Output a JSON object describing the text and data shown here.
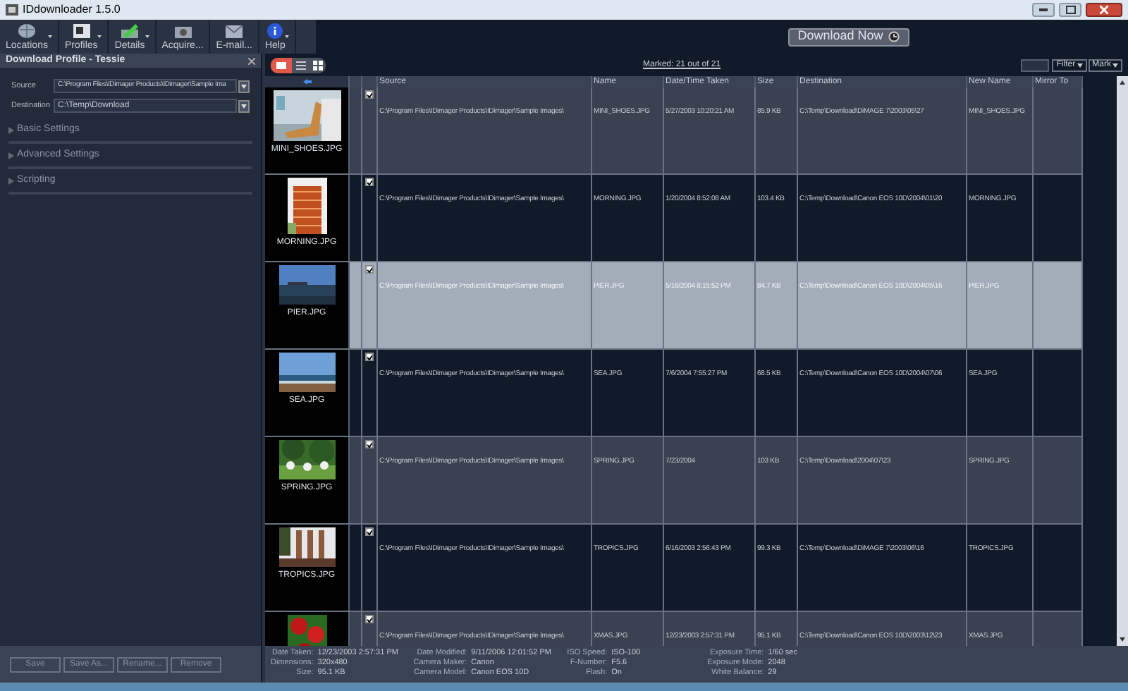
{
  "window": {
    "title": "IDdownloader 1.5.0"
  },
  "toolbar": [
    {
      "label": "Locations",
      "dropdown": true
    },
    {
      "label": "Profiles",
      "dropdown": true
    },
    {
      "label": "Details",
      "dropdown": true
    },
    {
      "label": "Acquire...",
      "dropdown": false
    },
    {
      "label": "E-mail...",
      "dropdown": false
    },
    {
      "label": "Help",
      "dropdown": true
    }
  ],
  "download_button": {
    "label": "Download Now"
  },
  "profile_panel": {
    "title": "Download Profile - Tessie",
    "source_label": "Source",
    "source_value": "C:\\Program Files\\IDimager Products\\IDimager\\Sample Ima",
    "destination_label": "Destination",
    "destination_value": "C:\\Temp\\Download",
    "sections": [
      {
        "label": "Basic Settings",
        "expanded": false
      },
      {
        "label": "Advanced Settings",
        "expanded": false
      },
      {
        "label": "Scripting",
        "expanded": false
      }
    ],
    "buttons": [
      "Save",
      "Save As...",
      "Rename...",
      "Remove"
    ]
  },
  "view_modes": [
    {
      "selected": true
    },
    {
      "selected": false
    },
    {
      "selected": false
    }
  ],
  "marked_link": "Marked: 21 out of 21",
  "filter_button": "Filter",
  "mark_button": "Mark",
  "table": {
    "columns": [
      "Source",
      "Name",
      "Date/Time Taken",
      "Size",
      "Destination",
      "New Name",
      "Mirror To"
    ],
    "rows": [
      {
        "caption": "MINI_SHOES.JPG",
        "checked": true,
        "selected": false,
        "cells": [
          "C:\\Program Files\\IDimager Products\\IDimager\\Sample Images\\",
          "MINI_SHOES.JPG",
          "5/27/2003 10:20:21 AM",
          "85.9 KB",
          "C:\\Temp\\Download\\DiMAGE 7\\2003\\05\\27",
          "MINI_SHOES.JPG"
        ]
      },
      {
        "caption": "MORNING.JPG",
        "checked": true,
        "selected": false,
        "cells": [
          "C:\\Program Files\\IDimager Products\\IDimager\\Sample Images\\",
          "MORNING.JPG",
          "1/20/2004 8:52:08 AM",
          "103.4 KB",
          "C:\\Temp\\Download\\Canon EOS 10D\\2004\\01\\20",
          "MORNING.JPG"
        ]
      },
      {
        "caption": "PIER.JPG",
        "checked": true,
        "selected": true,
        "cells": [
          "C:\\Program Files\\IDimager Products\\IDimager\\Sample Images\\",
          "PIER.JPG",
          "5/16/2004 8:15:52 PM",
          "84.7 KB",
          "C:\\Temp\\Download\\Canon EOS 10D\\2004\\05\\16",
          "PIER.JPG"
        ]
      },
      {
        "caption": "SEA.JPG",
        "checked": true,
        "selected": false,
        "cells": [
          "C:\\Program Files\\IDimager Products\\IDimager\\Sample Images\\",
          "SEA.JPG",
          "7/6/2004 7:55:27 PM",
          "68.5 KB",
          "C:\\Temp\\Download\\Canon EOS 10D\\2004\\07\\06",
          "SEA.JPG"
        ]
      },
      {
        "caption": "SPRING.JPG",
        "checked": true,
        "selected": false,
        "cells": [
          "C:\\Program Files\\IDimager Products\\IDimager\\Sample Images\\",
          "SPRING.JPG",
          "7/23/2004",
          "103 KB",
          "C:\\Temp\\Download\\2004\\07\\23",
          "SPRING.JPG"
        ]
      },
      {
        "caption": "TROPICS.JPG",
        "checked": true,
        "selected": false,
        "cells": [
          "C:\\Program Files\\IDimager Products\\IDimager\\Sample Images\\",
          "TROPICS.JPG",
          "6/16/2003 2:56:43 PM",
          "99.3 KB",
          "C:\\Temp\\Download\\DiMAGE 7\\2003\\06\\16",
          "TROPICS.JPG"
        ]
      },
      {
        "checked": true,
        "selected": false,
        "cells": [
          "C:\\Program Files\\IDimager Products\\IDimager\\Sample Images\\",
          "XMAS.JPG",
          "12/23/2003 2:57:31 PM",
          "95.1 KB",
          "C:\\Temp\\Download\\Canon EOS 10D\\2003\\12\\23",
          "XMAS.JPG"
        ]
      }
    ]
  },
  "details": [
    [
      {
        "label": "Date Taken:",
        "value": "12/23/2003 2:57:31 PM"
      },
      {
        "label": "Dimensions:",
        "value": "320x480"
      },
      {
        "label": "Size:",
        "value": "95.1 KB"
      }
    ],
    [
      {
        "label": "Date Modified:",
        "value": "9/11/2006 12:01:52 PM"
      },
      {
        "label": "Camera Maker:",
        "value": "Canon"
      },
      {
        "label": "Camera Model:",
        "value": "Canon EOS 10D"
      }
    ],
    [
      {
        "label": "ISO Speed:",
        "value": "ISO-100"
      },
      {
        "label": "F-Number:",
        "value": "F5.6"
      },
      {
        "label": "Flash:",
        "value": "On"
      }
    ],
    [
      {
        "label": "Exposure Time:",
        "value": "1/60 sec"
      },
      {
        "label": "Exposure Mode:",
        "value": "2048"
      },
      {
        "label": "White Balance:",
        "value": "29"
      }
    ]
  ]
}
